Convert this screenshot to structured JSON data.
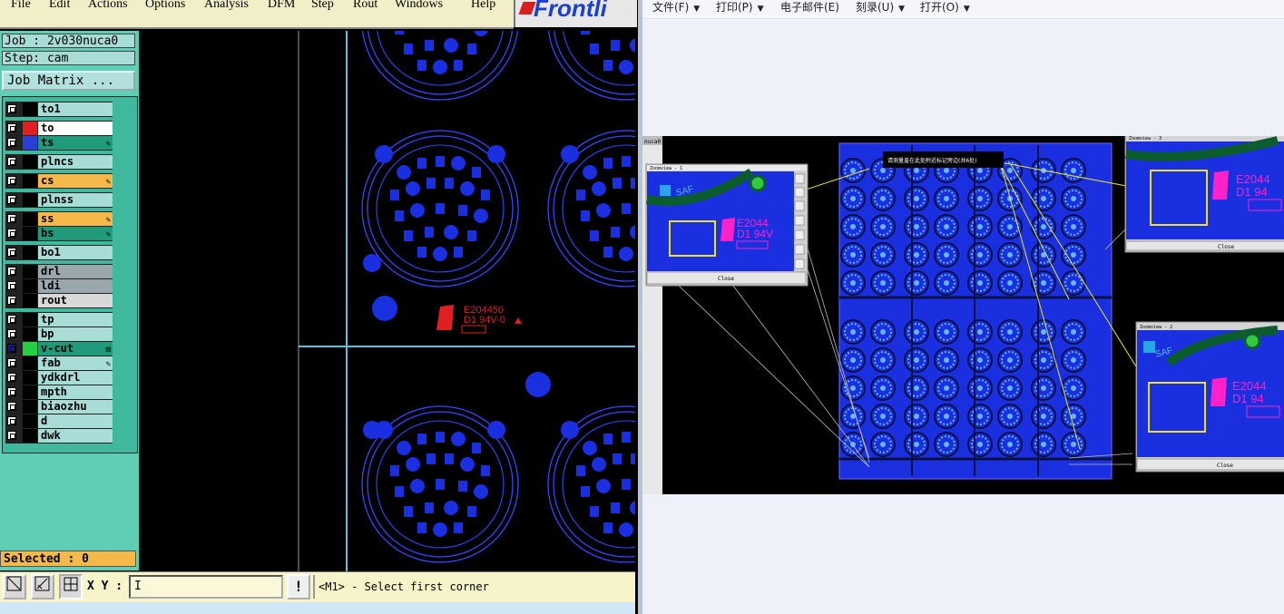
{
  "menu": {
    "items": [
      "File",
      "Edit",
      "Actions",
      "Options",
      "Analysis",
      "DFM",
      "Step",
      "Rout",
      "Windows",
      "Help"
    ],
    "logo_text": "Frontli"
  },
  "job": {
    "job_label": "Job : 2v030nuca0",
    "step_label": "Step: cam",
    "job_matrix_button": "Job Matrix ..."
  },
  "layers": [
    {
      "name": "to1",
      "color": "#000000",
      "bg": "#a8dcd6",
      "flag": ""
    },
    {
      "name": "to",
      "color": "#e02020",
      "bg": "#ffffff",
      "flag": ""
    },
    {
      "name": "ts",
      "color": "#2a3fd8",
      "bg": "#1f9a7a",
      "flag": "✎"
    },
    {
      "name": "plncs",
      "color": "#000000",
      "bg": "#a8dcd6",
      "flag": ""
    },
    {
      "name": "cs",
      "color": "#000000",
      "bg": "#f5b84a",
      "flag": "✎"
    },
    {
      "name": "plnss",
      "color": "#000000",
      "bg": "#a8dcd6",
      "flag": ""
    },
    {
      "name": "ss",
      "color": "#000000",
      "bg": "#f5b84a",
      "flag": "✎"
    },
    {
      "name": "bs",
      "color": "#000000",
      "bg": "#1f9a7a",
      "flag": "✎"
    },
    {
      "name": "bo1",
      "color": "#000000",
      "bg": "#a8dcd6",
      "flag": ""
    },
    {
      "name": "drl",
      "color": "#000000",
      "bg": "#9aa7ad",
      "flag": ""
    },
    {
      "name": "ldi",
      "color": "#000000",
      "bg": "#9aa7ad",
      "flag": ""
    },
    {
      "name": "rout",
      "color": "#000000",
      "bg": "#d8d8d8",
      "flag": ""
    },
    {
      "name": "tp",
      "color": "#000000",
      "bg": "#a8dcd6",
      "flag": ""
    },
    {
      "name": "bp",
      "color": "#000000",
      "bg": "#a8dcd6",
      "flag": ""
    },
    {
      "name": "v-cut",
      "color": "#22d040",
      "bg": "#1f9a7a",
      "flag": "⊞"
    },
    {
      "name": "fab",
      "color": "#000000",
      "bg": "#a8dcd6",
      "flag": "✎"
    },
    {
      "name": "ydkdrl",
      "color": "#000000",
      "bg": "#a8dcd6",
      "flag": ""
    },
    {
      "name": "mpth",
      "color": "#000000",
      "bg": "#a8dcd6",
      "flag": ""
    },
    {
      "name": "biaozhu",
      "color": "#000000",
      "bg": "#a8dcd6",
      "flag": ""
    },
    {
      "name": "d",
      "color": "#000000",
      "bg": "#a8dcd6",
      "flag": ""
    },
    {
      "name": "dwk",
      "color": "#000000",
      "bg": "#a8dcd6",
      "flag": ""
    }
  ],
  "selected_label": "Selected : 0",
  "statusbar": {
    "xy_label": "X Y :",
    "xy_value": "I",
    "warn_label": "!",
    "prompt": "<M1> - Select first corner"
  },
  "pcb_marking": {
    "line1": "E204450",
    "line2": "D1 94V-0"
  },
  "viewer": {
    "toolbar": [
      {
        "label": "文件(F)",
        "dropdown": "▼"
      },
      {
        "label": "打印(P)",
        "dropdown": "▼"
      },
      {
        "label": "电子邮件(E)",
        "dropdown": ""
      },
      {
        "label": "刻录(U)",
        "dropdown": "▼"
      },
      {
        "label": "打开(O)",
        "dropdown": "▼"
      }
    ],
    "job_tab": "nuca0",
    "zoom_windows": [
      {
        "title": "Zoomview - 1",
        "close": "Close",
        "marking1": "E2044",
        "marking2": "D1 94V",
        "saf": "SAF"
      },
      {
        "title": "Zoomview - 3",
        "close": "Close",
        "marking1": "E2044",
        "marking2": "D1 94",
        "saf": ""
      },
      {
        "title": "Zoomview - 2",
        "close": "Close",
        "marking1": "E2044",
        "marking2": "D1 94",
        "saf": "SAF"
      }
    ],
    "tooltip": "请测量盖在此处附近标记旁边(共6处)"
  },
  "colors": {
    "pcb_blue": "#1a2fe0",
    "outline_blue": "#3646ff",
    "mark_red": "#e02020",
    "crosshair": "#4ec3e6",
    "viewer_bg": "#eef1fa"
  }
}
